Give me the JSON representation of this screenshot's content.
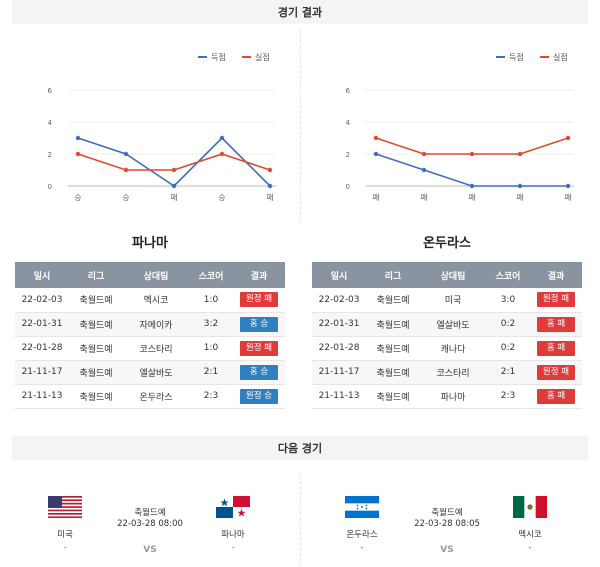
{
  "headers": {
    "results": "경기 결과",
    "next": "다음 경기"
  },
  "legend": {
    "for": "득점",
    "against": "실점"
  },
  "colors": {
    "for": "#3f6fba",
    "against": "#e04a2e",
    "win": "#2f7fc1",
    "loss": "#e03b3b"
  },
  "chart_data": [
    {
      "type": "line",
      "categories": [
        "승",
        "승",
        "패",
        "승",
        "패"
      ],
      "series": [
        {
          "name": "득점",
          "values": [
            3,
            2,
            0,
            3,
            0
          ]
        },
        {
          "name": "실점",
          "values": [
            2,
            1,
            1,
            2,
            1
          ]
        }
      ],
      "yticks": [
        0,
        2,
        4,
        6
      ],
      "ylim": [
        0,
        6
      ],
      "legend": "top-right"
    },
    {
      "type": "line",
      "categories": [
        "패",
        "패",
        "패",
        "패",
        "패"
      ],
      "series": [
        {
          "name": "득점",
          "values": [
            2,
            1,
            0,
            0,
            0
          ]
        },
        {
          "name": "실점",
          "values": [
            3,
            2,
            2,
            2,
            3
          ]
        }
      ],
      "yticks": [
        0,
        2,
        4,
        6
      ],
      "ylim": [
        0,
        6
      ],
      "legend": "top-right"
    }
  ],
  "table_headers": [
    "일시",
    "리그",
    "상대팀",
    "스코어",
    "결과"
  ],
  "teams": [
    {
      "name": "파나마",
      "rows": [
        {
          "date": "22-02-03",
          "league": "축월드예",
          "opponent": "멕시코",
          "score": "1:0",
          "result": "원정 패",
          "color": "red"
        },
        {
          "date": "22-01-31",
          "league": "축월드예",
          "opponent": "자메이카",
          "score": "3:2",
          "result": "홈 승",
          "color": "blue"
        },
        {
          "date": "22-01-28",
          "league": "축월드예",
          "opponent": "코스타리",
          "score": "1:0",
          "result": "원정 패",
          "color": "red"
        },
        {
          "date": "21-11-17",
          "league": "축월드예",
          "opponent": "엘살바도",
          "score": "2:1",
          "result": "홈 승",
          "color": "blue"
        },
        {
          "date": "21-11-13",
          "league": "축월드예",
          "opponent": "온두라스",
          "score": "2:3",
          "result": "원정 승",
          "color": "blue"
        }
      ]
    },
    {
      "name": "온두라스",
      "rows": [
        {
          "date": "22-02-03",
          "league": "축월드예",
          "opponent": "미국",
          "score": "3:0",
          "result": "원정 패",
          "color": "red"
        },
        {
          "date": "22-01-31",
          "league": "축월드예",
          "opponent": "엘살바도",
          "score": "0:2",
          "result": "홈 패",
          "color": "red"
        },
        {
          "date": "22-01-28",
          "league": "축월드예",
          "opponent": "캐나다",
          "score": "0:2",
          "result": "홈 패",
          "color": "red"
        },
        {
          "date": "21-11-17",
          "league": "축월드예",
          "opponent": "코스타리",
          "score": "2:1",
          "result": "원정 패",
          "color": "red"
        },
        {
          "date": "21-11-13",
          "league": "축월드예",
          "opponent": "파나마",
          "score": "2:3",
          "result": "홈 패",
          "color": "red"
        }
      ]
    }
  ],
  "next_matches": [
    {
      "home": {
        "name": "미국",
        "score": "-",
        "flag": "usa-flag"
      },
      "away": {
        "name": "파나마",
        "score": "-",
        "flag": "panama-flag"
      },
      "league": "축월드예",
      "date": "22-03-28 08:00",
      "vs": "VS"
    },
    {
      "home": {
        "name": "온두라스",
        "score": "-",
        "flag": "honduras-flag"
      },
      "away": {
        "name": "멕시코",
        "score": "-",
        "flag": "mexico-flag"
      },
      "league": "축월드예",
      "date": "22-03-28 08:05",
      "vs": "VS"
    }
  ]
}
